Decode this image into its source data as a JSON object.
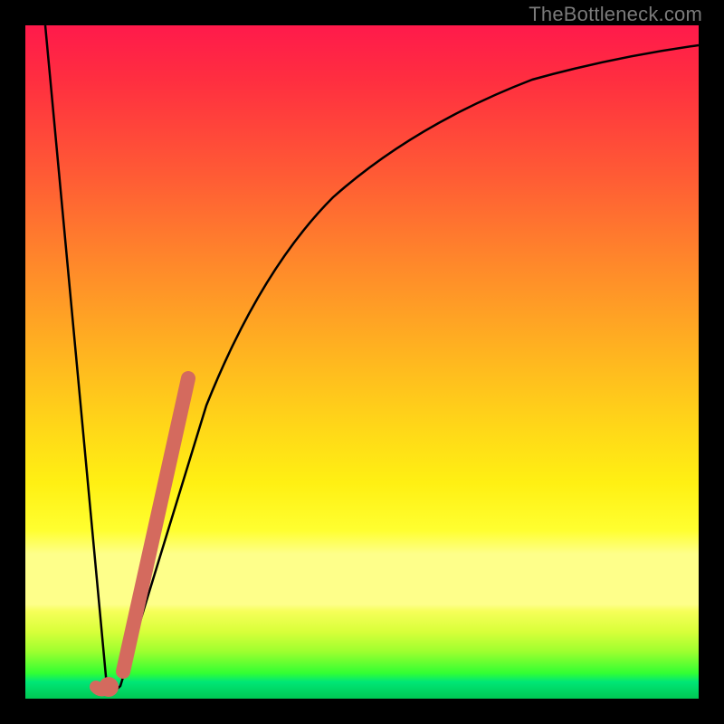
{
  "watermark": "TheBottleneck.com",
  "colors": {
    "frame": "#000000",
    "gradient_top": "#ff1a4b",
    "gradient_mid": "#ffff30",
    "gradient_bottom": "#00c853",
    "curve": "#000000",
    "highlight": "#d46a5e"
  },
  "chart_data": {
    "type": "line",
    "title": "",
    "xlabel": "",
    "ylabel": "",
    "xlim": [
      0,
      100
    ],
    "ylim": [
      0,
      100
    ],
    "grid": false,
    "legend": false,
    "series": [
      {
        "name": "bottleneck-curve",
        "x": [
          3,
          5,
          7,
          9,
          11,
          12,
          13,
          15,
          18,
          22,
          26,
          30,
          35,
          40,
          46,
          52,
          60,
          70,
          80,
          90,
          100
        ],
        "y": [
          100,
          78,
          55,
          32,
          10,
          2,
          2,
          10,
          25,
          42,
          55,
          65,
          73,
          79,
          84,
          87.5,
          90.5,
          93,
          94.8,
          96,
          97
        ]
      }
    ],
    "annotations": {
      "highlight_segment": {
        "x": [
          14,
          24
        ],
        "y": [
          5,
          48
        ]
      },
      "highlight_hook": {
        "cx": 12,
        "cy": 2,
        "r": 1.4
      }
    }
  }
}
